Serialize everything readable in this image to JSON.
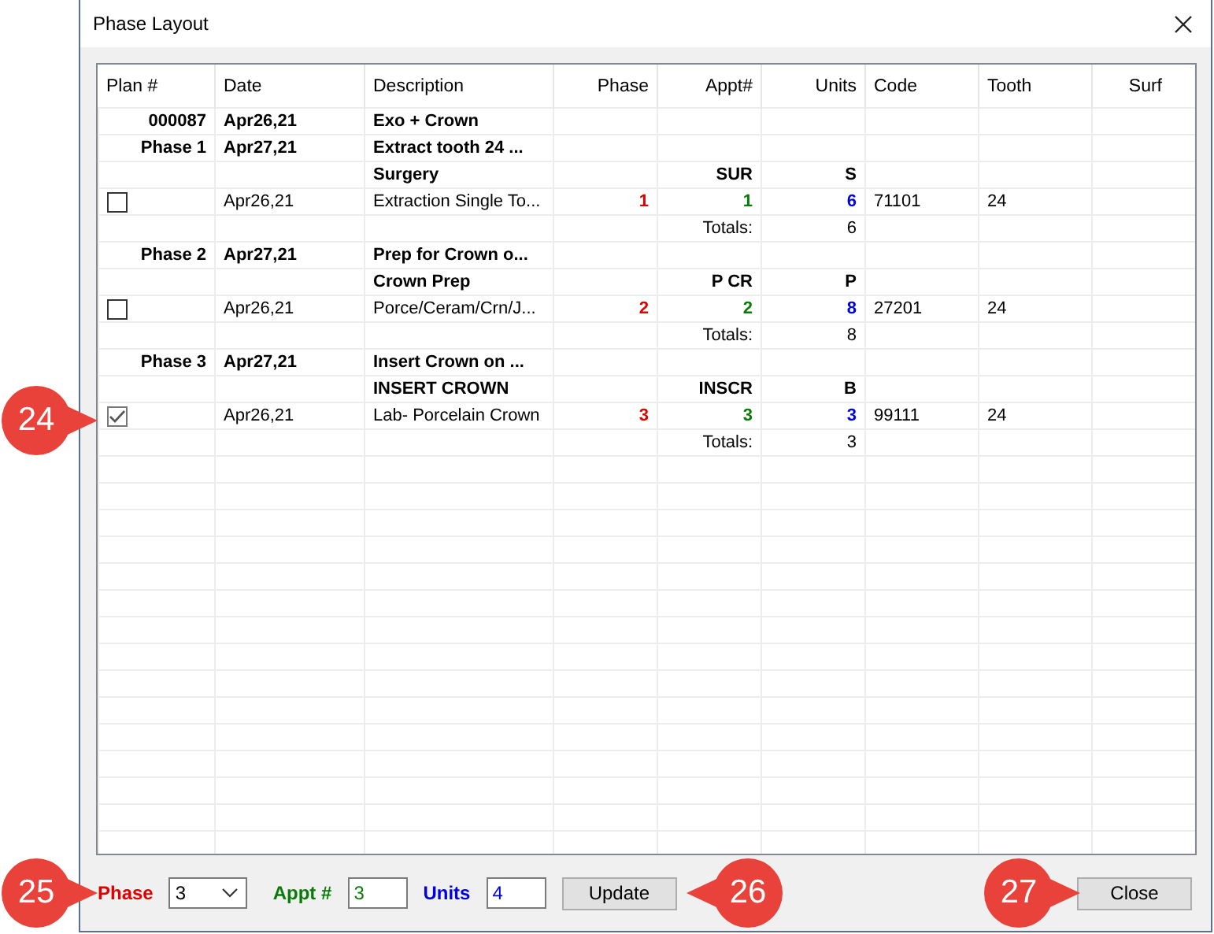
{
  "window": {
    "title": "Phase Layout"
  },
  "table": {
    "columns": [
      "Plan #",
      "Date",
      "Description",
      "Phase",
      "Appt#",
      "Units",
      "Code",
      "Tooth",
      "Surf"
    ],
    "rows": [
      {
        "kind": "plan",
        "plan": "000087",
        "date": "Apr26,21",
        "description": "Exo + Crown"
      },
      {
        "kind": "phase",
        "plan": "Phase 1",
        "date": "Apr27,21",
        "description": "Extract tooth 24 ..."
      },
      {
        "kind": "group",
        "description": "Surgery",
        "appt": "SUR",
        "units": "S"
      },
      {
        "kind": "item",
        "checked": false,
        "date": "Apr26,21",
        "description": "Extraction Single To...",
        "phase": "1",
        "appt": "1",
        "units": "6",
        "code": "71101",
        "tooth": "24"
      },
      {
        "kind": "totals",
        "label": "Totals:",
        "units": "6"
      },
      {
        "kind": "phase",
        "plan": "Phase 2",
        "date": "Apr27,21",
        "description": "Prep for Crown o..."
      },
      {
        "kind": "group",
        "description": "Crown Prep",
        "appt": "P CR",
        "units": "P"
      },
      {
        "kind": "item",
        "checked": false,
        "date": "Apr26,21",
        "description": "Porce/Ceram/Crn/J...",
        "phase": "2",
        "appt": "2",
        "units": "8",
        "code": "27201",
        "tooth": "24"
      },
      {
        "kind": "totals",
        "label": "Totals:",
        "units": "8"
      },
      {
        "kind": "phase",
        "plan": "Phase 3",
        "date": "Apr27,21",
        "description": "Insert Crown on ..."
      },
      {
        "kind": "group",
        "description": "INSERT CROWN",
        "appt": "INSCR",
        "units": "B"
      },
      {
        "kind": "item",
        "checked": true,
        "date": "Apr26,21",
        "description": "Lab- Porcelain Crown",
        "phase": "3",
        "appt": "3",
        "units": "3",
        "code": "99111",
        "tooth": "24"
      },
      {
        "kind": "totals",
        "label": "Totals:",
        "units": "3"
      }
    ]
  },
  "footer": {
    "phase_label": "Phase",
    "phase_value": "3",
    "appt_label": "Appt #",
    "appt_value": "3",
    "units_label": "Units",
    "units_value": "4",
    "update_button": "Update",
    "close_button": "Close"
  },
  "callouts": [
    {
      "label": "24"
    },
    {
      "label": "25"
    },
    {
      "label": "26"
    },
    {
      "label": "27"
    }
  ]
}
